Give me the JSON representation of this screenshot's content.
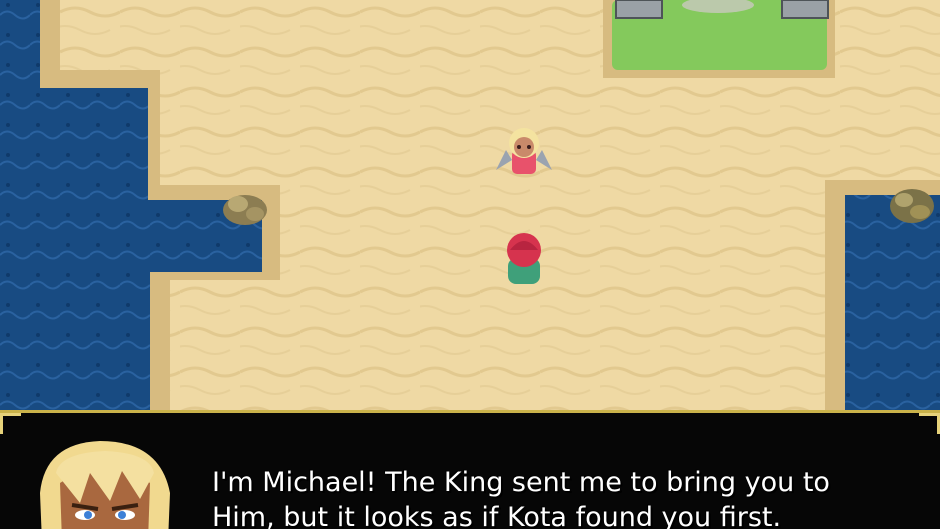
{
  "dialog": {
    "text": "I'm Michael! The King sent me to bring you to\nHim, but it looks as if Kota found you first."
  },
  "sprites": {
    "npc": "winged-girl-npc",
    "player": "red-haired-player",
    "speaker": "michael-portrait"
  },
  "colors": {
    "sand": "#eed8a2",
    "sand_dark": "#d9be84",
    "water": "#17457a",
    "grass": "#82c85a",
    "frame": "#c9b24a"
  }
}
